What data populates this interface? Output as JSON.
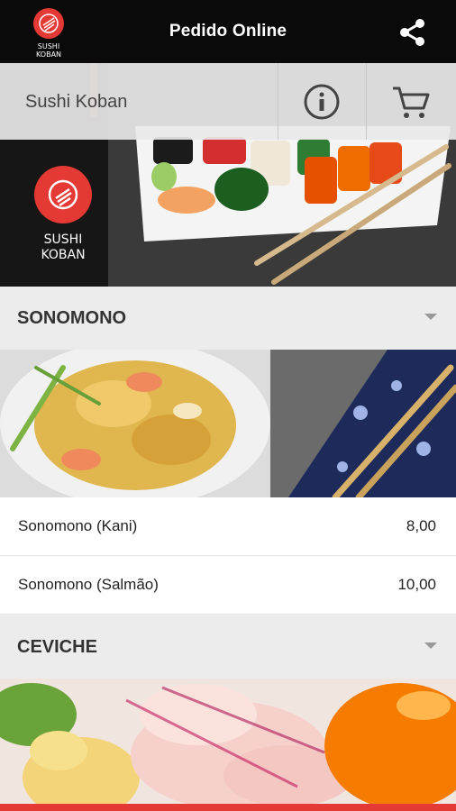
{
  "app": {
    "title": "Pedido Online",
    "logo_text_line1": "SUSHI",
    "logo_text_line2": "KOBAN"
  },
  "store": {
    "name": "Sushi Koban"
  },
  "icons": {
    "share": "share-icon",
    "info": "info-icon",
    "cart": "cart-icon"
  },
  "colors": {
    "topbar": "#0a0a0a",
    "brand_red": "#e53935",
    "category_bg": "#ececec"
  },
  "categories": [
    {
      "label": "SONOMONO",
      "items": [
        {
          "name": "Sonomono (Kani)",
          "price": "8,00"
        },
        {
          "name": "Sonomono (Salmão)",
          "price": "10,00"
        }
      ]
    },
    {
      "label": "CEVICHE",
      "items": []
    }
  ]
}
